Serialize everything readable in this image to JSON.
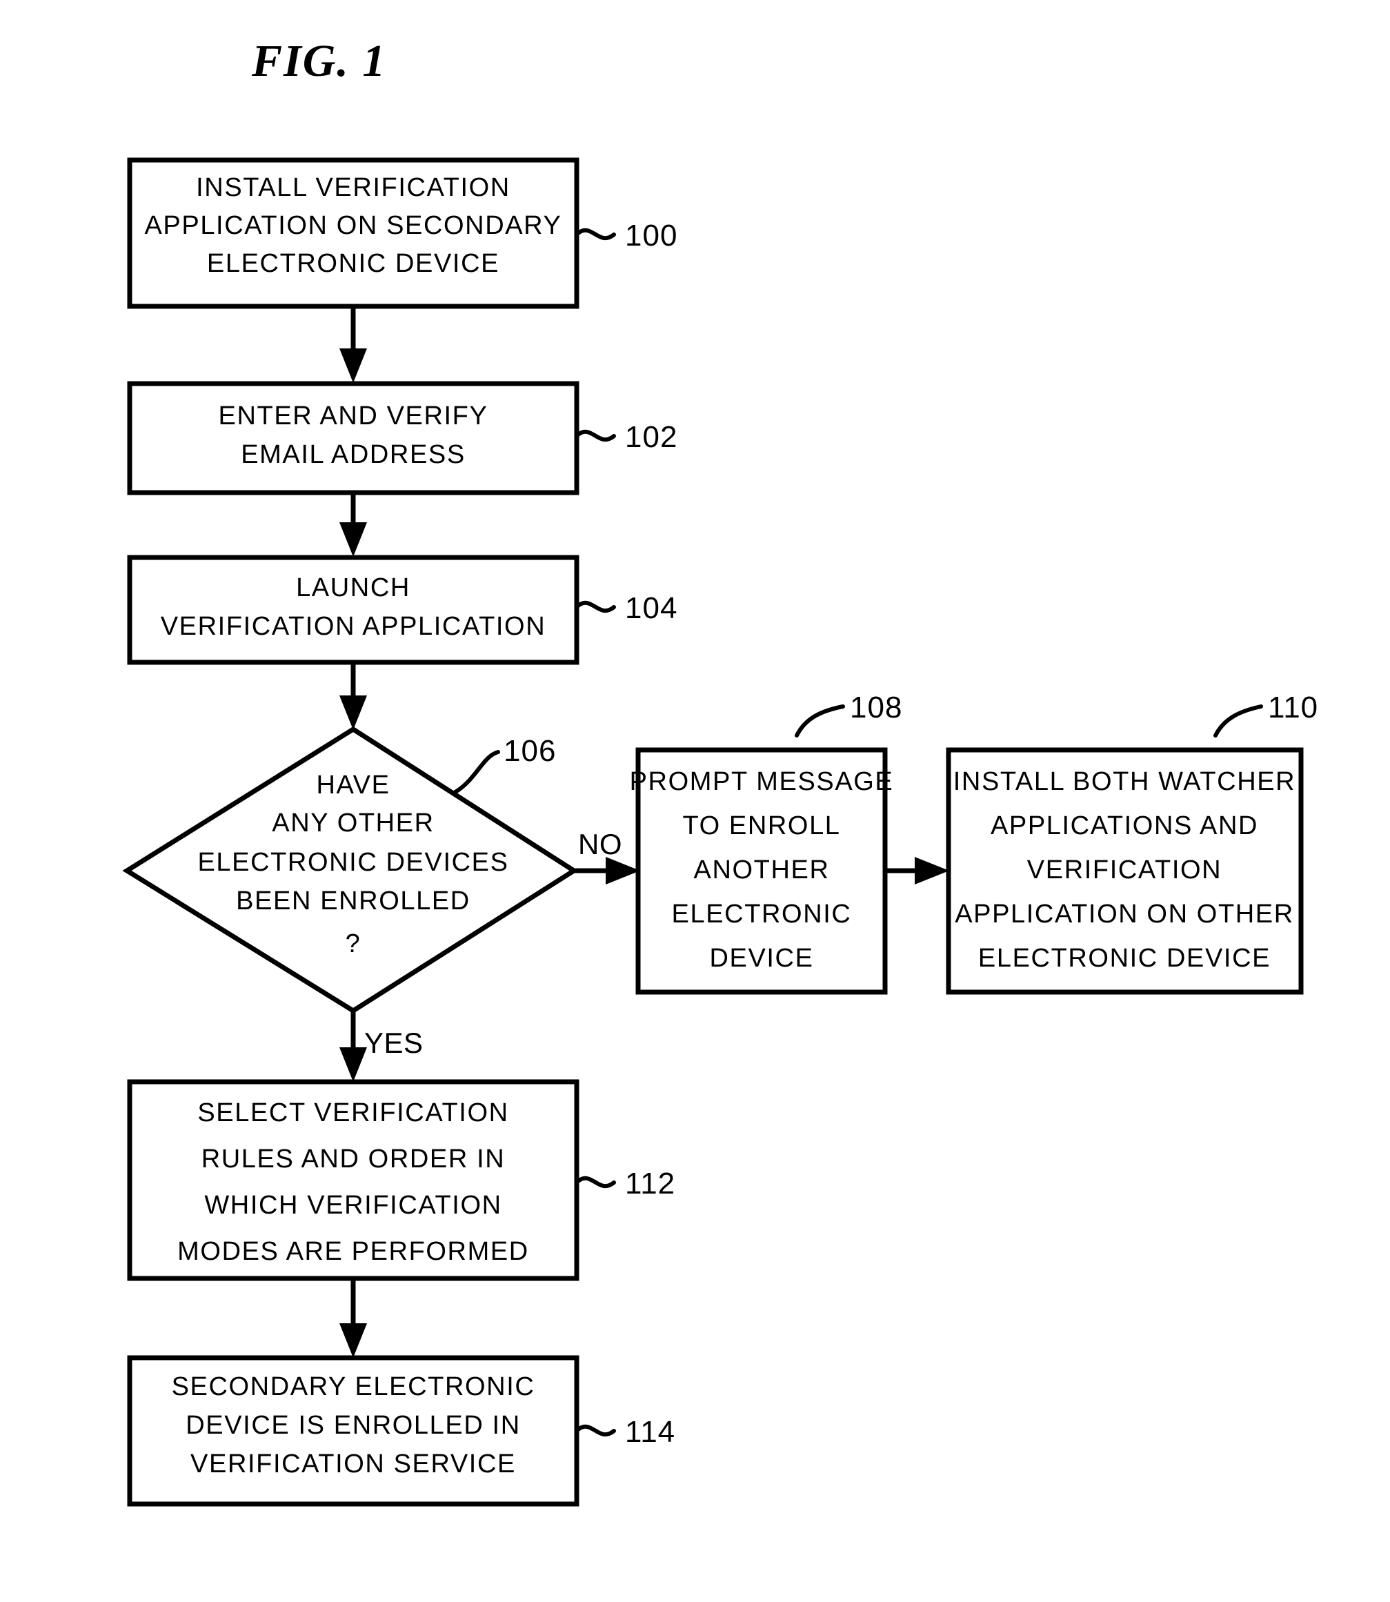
{
  "figure": {
    "title": "FIG.  1",
    "type": "patent-flowchart"
  },
  "nodes": [
    {
      "id": "n100",
      "ref": "100",
      "shape": "rectangle",
      "lines": [
        "INSTALL  VERIFICATION",
        "APPLICATION  ON  SECONDARY",
        "ELECTRONIC  DEVICE"
      ]
    },
    {
      "id": "n102",
      "ref": "102",
      "shape": "rectangle",
      "lines": [
        "ENTER  AND  VERIFY",
        "EMAIL  ADDRESS"
      ]
    },
    {
      "id": "n104",
      "ref": "104",
      "shape": "rectangle",
      "lines": [
        "LAUNCH",
        "VERIFICATION  APPLICATION"
      ]
    },
    {
      "id": "n106",
      "ref": "106",
      "shape": "diamond",
      "lines": [
        "HAVE",
        "ANY  OTHER",
        "ELECTRONIC  DEVICES",
        "BEEN  ENROLLED",
        "?"
      ]
    },
    {
      "id": "n108",
      "ref": "108",
      "shape": "rectangle",
      "lines": [
        "PROMPT  MESSAGE",
        "TO  ENROLL",
        "ANOTHER",
        "ELECTRONIC",
        "DEVICE"
      ]
    },
    {
      "id": "n110",
      "ref": "110",
      "shape": "rectangle",
      "lines": [
        "INSTALL  BOTH  WATCHER",
        "APPLICATIONS  AND",
        "VERIFICATION",
        "APPLICATION  ON  OTHER",
        "ELECTRONIC  DEVICE"
      ]
    },
    {
      "id": "n112",
      "ref": "112",
      "shape": "rectangle",
      "lines": [
        "SELECT  VERIFICATION",
        "RULES  AND  ORDER  IN",
        "WHICH  VERIFICATION",
        "MODES  ARE  PERFORMED"
      ]
    },
    {
      "id": "n114",
      "ref": "114",
      "shape": "rectangle",
      "lines": [
        "SECONDARY  ELECTRONIC",
        "DEVICE  IS  ENROLLED  IN",
        "VERIFICATION  SERVICE"
      ]
    }
  ],
  "branch_labels": {
    "no": "NO",
    "yes": "YES"
  },
  "colors": {
    "stroke": "#000000",
    "fill": "#ffffff",
    "background": "#ffffff"
  }
}
